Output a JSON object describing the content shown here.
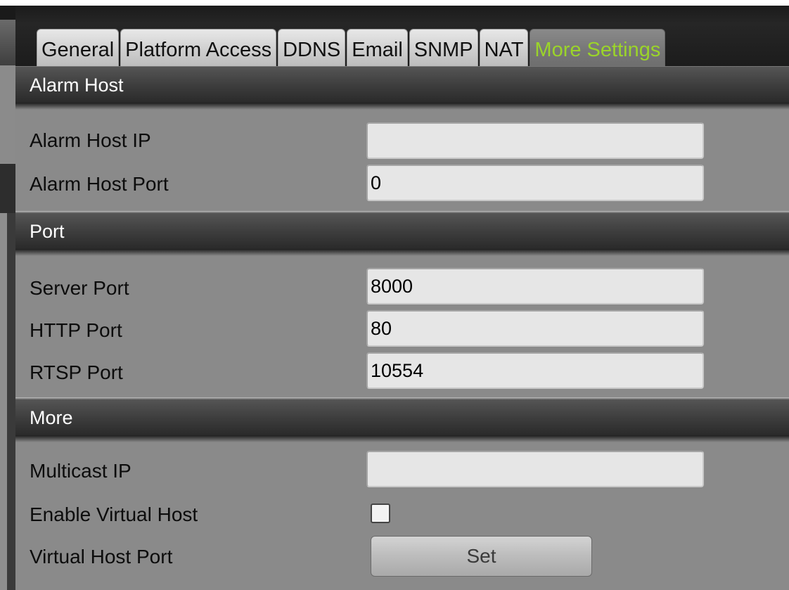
{
  "tabs": [
    {
      "label": "General"
    },
    {
      "label": "Platform Access"
    },
    {
      "label": "DDNS"
    },
    {
      "label": "Email"
    },
    {
      "label": "SNMP"
    },
    {
      "label": "NAT"
    },
    {
      "label": "More Settings",
      "active": true
    }
  ],
  "sections": {
    "alarm_host": {
      "title": "Alarm Host",
      "alarm_host_ip": {
        "label": "Alarm Host IP",
        "value": ""
      },
      "alarm_host_port": {
        "label": "Alarm Host Port",
        "value": "0"
      }
    },
    "port": {
      "title": "Port",
      "server_port": {
        "label": "Server Port",
        "value": "8000"
      },
      "http_port": {
        "label": "HTTP Port",
        "value": "80"
      },
      "rtsp_port": {
        "label": "RTSP Port",
        "value": "10554"
      }
    },
    "more": {
      "title": "More",
      "multicast_ip": {
        "label": "Multicast IP",
        "value": ""
      },
      "enable_virtual_host": {
        "label": "Enable Virtual Host",
        "checked": false
      },
      "virtual_host_port": {
        "label": "Virtual Host Port",
        "button_label": "Set"
      }
    }
  },
  "colors": {
    "active_tab_text": "#9bd42a",
    "panel_bg": "#8a8a8a",
    "header_bg": "#3c3c3c"
  }
}
